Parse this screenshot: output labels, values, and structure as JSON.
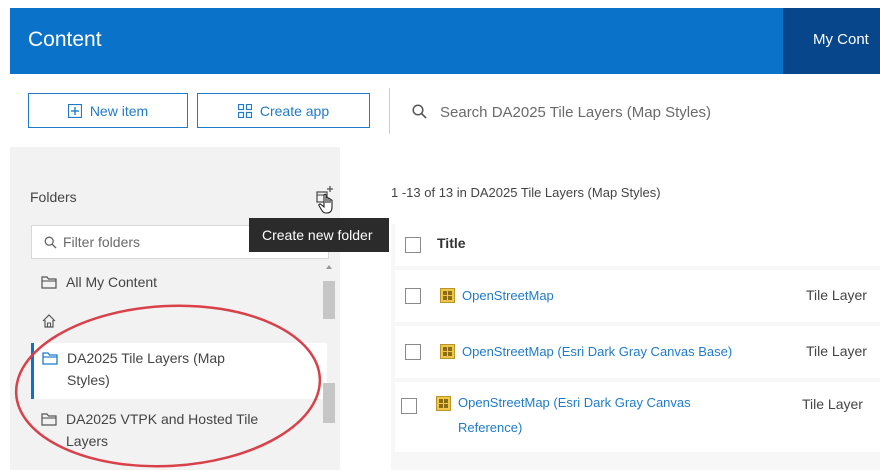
{
  "header": {
    "title": "Content",
    "tab_label": "My Cont"
  },
  "toolbar": {
    "new_item_label": "New item",
    "create_app_label": "Create app",
    "search_placeholder": "Search DA2025 Tile Layers (Map Styles)"
  },
  "sidebar": {
    "folders_title": "Folders",
    "filter_placeholder": "Filter folders",
    "tooltip": "Create new folder",
    "items": [
      {
        "label": "All My Content"
      },
      {
        "label": ""
      },
      {
        "label": "DA2025 Tile Layers (Map Styles)"
      },
      {
        "label": "DA2025 VTPK and Hosted Tile Layers"
      }
    ]
  },
  "main": {
    "results_text": "1 -13  of 13 in DA2025 Tile Layers (Map Styles)",
    "column_title": "Title",
    "rows": [
      {
        "title": "OpenStreetMap",
        "type": "Tile Layer"
      },
      {
        "title": "OpenStreetMap (Esri Dark Gray Canvas Base)",
        "type": "Tile Layer"
      },
      {
        "title": "OpenStreetMap (Esri Dark Gray Canvas Reference)",
        "type": "Tile Layer"
      }
    ]
  },
  "colors": {
    "header_blue": "#0a72c9",
    "active_tab": "#07468a",
    "link_blue": "#1f7bc9",
    "annotation_red": "#d9414a"
  }
}
